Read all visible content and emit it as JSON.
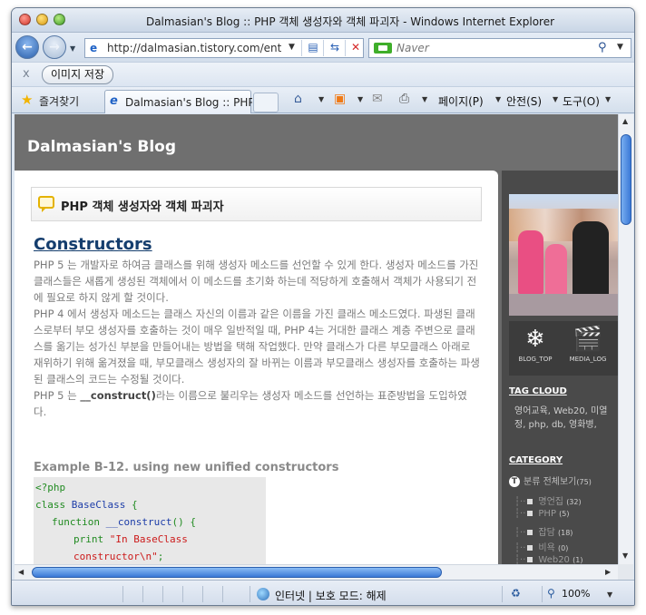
{
  "window": {
    "title": "Dalmasian's Blog :: PHP 객체 생성자와 객체 파괴자 - Windows Internet Explorer"
  },
  "address_bar": {
    "url": "http://dalmasian.tistory.com/ent",
    "search_placeholder": "Naver"
  },
  "image_toolbar": {
    "close_label": "x",
    "save_image_label": "이미지 저장"
  },
  "favorites_bar": {
    "favorites_label": "즐겨찾기",
    "tab_label": "Dalmasian's Blog :: PHP ...",
    "page_menu": "페이지(P)",
    "safety_menu": "안전(S)",
    "tools_menu": "도구(O)"
  },
  "blog": {
    "title": "Dalmasian's Blog",
    "post_title": "PHP 객체 생성자와 객체 파괴자",
    "section_heading": "Constructors",
    "paragraphs": [
      "PHP 5 는 개발자로 하여금 클래스를 위해 생성자 메소드를 선언할 수 있게 한다. 생성자 메소드를 가진 클래스들은 새롭게 생성된 객체에서 이 메소드를 초기화 하는데 적당하게 호출해서 객체가 사용되기 전에 필요로 하지 않게 할 것이다.",
      "PHP 4 에서 생성자 메소드는 클래스 자신의 이름과 같은 이름을 가진 클래스 메소드였다. 파생된 클래스로부터 부모 생성자를 호출하는 것이 매우 일반적일 때, PHP 4는 거대한 클래스 계층 주변으로 클래스를 옮기는 성가신 부분을 만들어내는 방법을 택해 작업했다. 만약 클래스가 다른 부모클래스 아래로 재위하기 위해 옮겨졌을 때, 부모클래스 생성자의 잘 바뀌는 이름과 부모클래스 생성자를 호출하는 파생된 클래스의 코드는 수정될 것이다."
    ],
    "p3_before": "PHP 5 는 ",
    "p3_code": "__construct()",
    "p3_after": "라는 이름으로 불리우는 생성자 메소드를 선언하는 표준방법을 도입하였다.",
    "example_heading": "Example B-12. using new unified constructors",
    "code": {
      "line1": "<?php",
      "line2_kw": "class",
      "line2_name": "BaseClass",
      "line2_end": " {",
      "line3_kw": "function",
      "line3_name": "__construct",
      "line3_end": "() {",
      "line4_kw": "print",
      "line4_str": "\"In BaseClass constructor\\n\"",
      "line4_end": ";",
      "line5": "}",
      "line6": "}"
    }
  },
  "sidebar": {
    "icons": [
      {
        "label": "BLOG_TOP",
        "icon": "snowflake-icon"
      },
      {
        "label": "MEDIA_LOG",
        "icon": "clapperboard-icon"
      }
    ],
    "tag_cloud_heading": "TAG CLOUD",
    "tag_cloud_text": "영어교육, Web20, 미열정, php, db, 영화병,",
    "category_heading": "CATEGORY",
    "category_root": "분류 전체보기",
    "category_root_count": "(75)",
    "categories": [
      {
        "name": "명언집",
        "count": "(32)"
      },
      {
        "name": "PHP",
        "count": "(5)"
      },
      {
        "name": "잡담",
        "count": "(18)"
      },
      {
        "name": "비욕",
        "count": "(0)"
      },
      {
        "name": "Web20",
        "count": "(1)"
      }
    ]
  },
  "status_bar": {
    "zone_text": "인터넷 | 보호 모드: 해제",
    "zoom": "100%"
  },
  "colors": {
    "link_heading": "#153e6e",
    "sidebar_bg": "#4a4a4a",
    "header_bg": "#6f6f6f"
  }
}
